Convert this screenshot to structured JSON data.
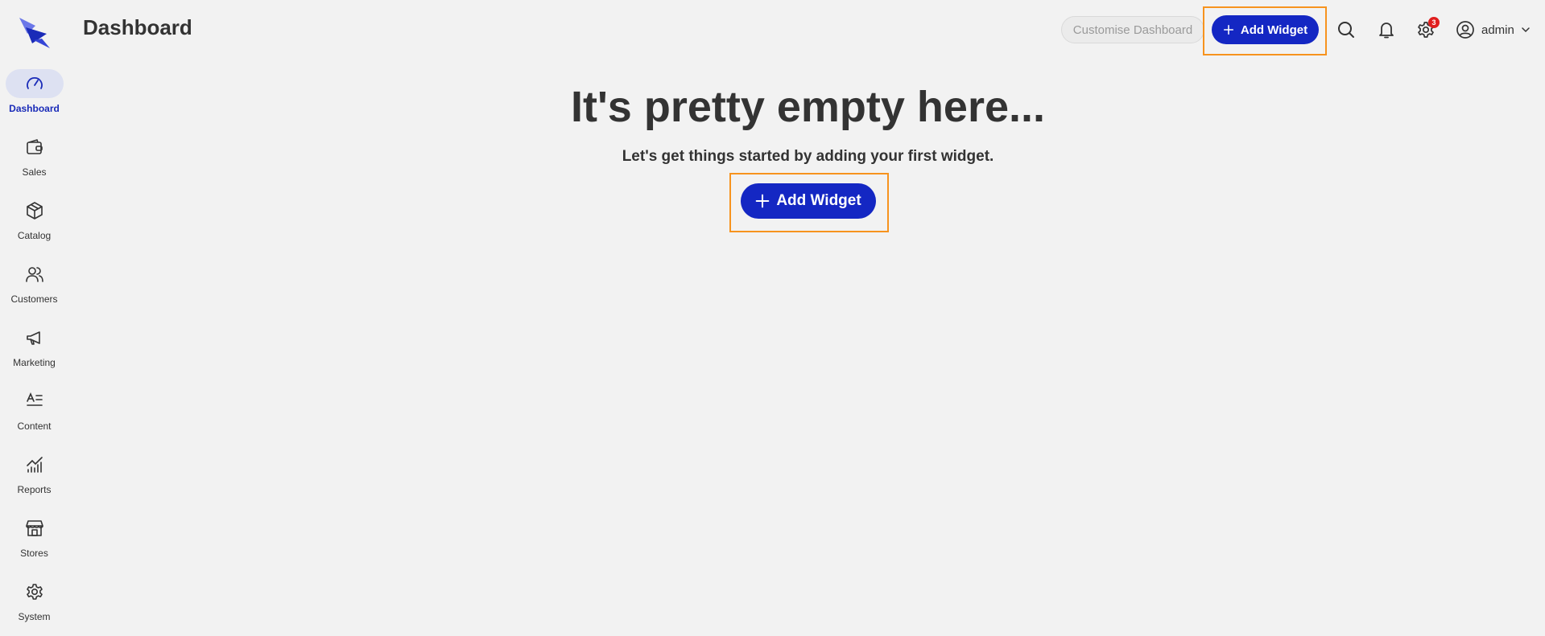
{
  "header": {
    "title": "Dashboard",
    "customise_label": "Customise Dashboard",
    "add_widget_label": "Add Widget",
    "notifications_badge": "3",
    "username": "admin"
  },
  "sidebar": {
    "items": [
      {
        "label": "Dashboard",
        "icon": "gauge-icon",
        "active": true
      },
      {
        "label": "Sales",
        "icon": "wallet-icon"
      },
      {
        "label": "Catalog",
        "icon": "box-icon"
      },
      {
        "label": "Customers",
        "icon": "users-icon"
      },
      {
        "label": "Marketing",
        "icon": "megaphone-icon"
      },
      {
        "label": "Content",
        "icon": "content-icon"
      },
      {
        "label": "Reports",
        "icon": "chart-icon"
      },
      {
        "label": "Stores",
        "icon": "store-icon"
      },
      {
        "label": "System",
        "icon": "gear-icon"
      }
    ]
  },
  "main": {
    "empty_title": "It's pretty empty here...",
    "empty_subtitle": "Let's get things started by adding your first widget.",
    "add_widget_label": "Add Widget"
  },
  "colors": {
    "accent": "#1427c3",
    "highlight": "#f7931e",
    "background": "#f2f2f2",
    "badge": "#e01e1e"
  }
}
